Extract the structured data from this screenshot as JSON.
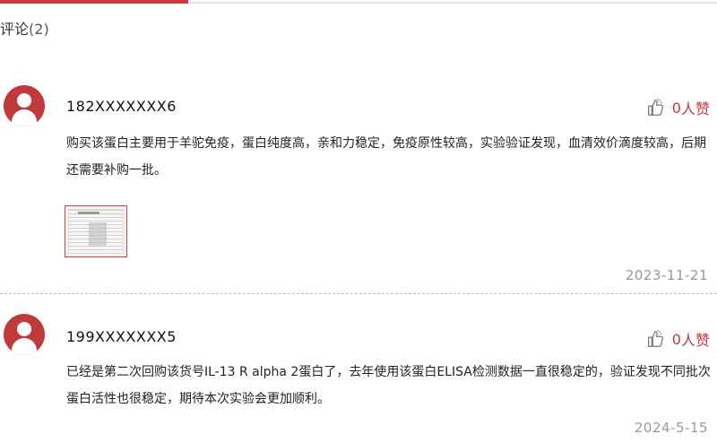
{
  "section": {
    "title": "评论",
    "count": "(2)"
  },
  "comments": [
    {
      "username": "182XXXXXXX6",
      "likes_count": "0",
      "likes_unit": "人赞",
      "text": "购买该蛋白主要用于羊驼免疫，蛋白纯度高，亲和力稳定，免疫原性较高，实验验证发现，血清效价滴度较高，后期还需要补购一批。",
      "has_image": true,
      "date": "2023-11-21"
    },
    {
      "username": "199XXXXXXX5",
      "likes_count": "0",
      "likes_unit": "人赞",
      "text": "已经是第二次回购该货号IL-13 R alpha 2蛋白了，去年使用该蛋白ELISA检测数据一直很稳定的，验证发现不同批次蛋白活性也很稳定，期待本次实验会更加顺利。",
      "has_image": false,
      "date": "2024-5-15"
    }
  ],
  "icons": {
    "avatar": "user-avatar-icon",
    "like": "thumbs-up-icon"
  },
  "colors": {
    "accent": "#c0393b",
    "muted": "#999999"
  }
}
